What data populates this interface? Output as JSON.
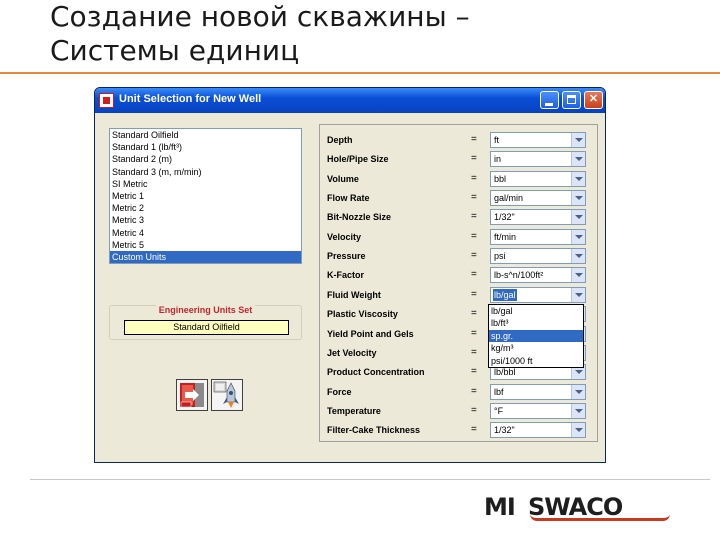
{
  "slide": {
    "title_line1": "Создание новой скважины –",
    "title_line2": "Системы единиц"
  },
  "window": {
    "title": "Unit Selection for New Well"
  },
  "presets": [
    "Standard Oilfield",
    "Standard 1 (lb/ft³)",
    "Standard 2 (m)",
    "Standard 3 (m, m/min)",
    "SI Metric",
    "Metric 1",
    "Metric 2",
    "Metric 3",
    "Metric 4",
    "Metric 5",
    "Custom Units"
  ],
  "selected_preset": "Custom Units",
  "engineering_units": {
    "title": "Engineering Units Set",
    "value": "Standard Oilfield"
  },
  "units": [
    {
      "label": "Depth",
      "value": "ft"
    },
    {
      "label": "Hole/Pipe Size",
      "value": "in"
    },
    {
      "label": "Volume",
      "value": "bbl"
    },
    {
      "label": "Flow Rate",
      "value": "gal/min"
    },
    {
      "label": "Bit-Nozzle Size",
      "value": "1/32\""
    },
    {
      "label": "Velocity",
      "value": "ft/min"
    },
    {
      "label": "Pressure",
      "value": "psi"
    },
    {
      "label": "K-Factor",
      "value": "lb-s^n/100ft²"
    },
    {
      "label": "Fluid Weight",
      "value": "lb/gal"
    },
    {
      "label": "Plastic Viscosity",
      "value": ""
    },
    {
      "label": "Yield Point and Gels",
      "value": ""
    },
    {
      "label": "Jet Velocity",
      "value": ""
    },
    {
      "label": "Product Concentration",
      "value": "lb/bbl"
    },
    {
      "label": "Force",
      "value": "lbf"
    },
    {
      "label": "Temperature",
      "value": "°F"
    },
    {
      "label": "Filter-Cake Thickness",
      "value": "1/32\""
    }
  ],
  "equals_sign": "=",
  "fluid_weight_options": [
    "lb/gal",
    "lb/ft³",
    "sp.gr.",
    "kg/m³",
    "psi/1000 ft"
  ],
  "fluid_weight_active_option": "sp.gr.",
  "icons": {
    "exit_button": "exit-door-icon",
    "ok_button": "rocket-launch-icon"
  },
  "colors": {
    "selection": "#316ac5",
    "engineering_title": "#c0282e",
    "engineering_field": "#ffffc0",
    "title_accent": "#e08a3a",
    "logo_red": "#c83a1e"
  },
  "logo": {
    "mi": "MI",
    "swaco": "SWACO"
  }
}
